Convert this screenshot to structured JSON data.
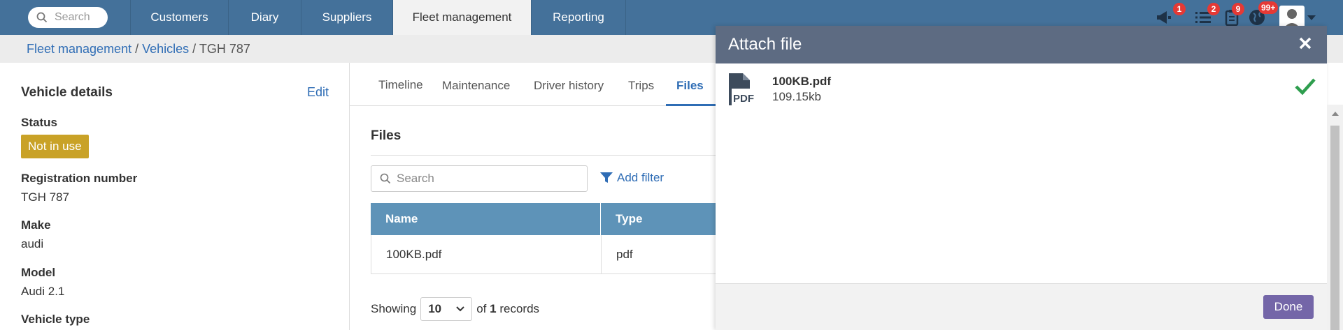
{
  "nav": {
    "search_placeholder": "Search",
    "tabs": [
      {
        "label": "Customers"
      },
      {
        "label": "Diary"
      },
      {
        "label": "Suppliers"
      },
      {
        "label": "Fleet management"
      },
      {
        "label": "Reporting"
      }
    ],
    "badges": {
      "announcements": "1",
      "tasks": "2",
      "clipboard": "9",
      "globe": "99+"
    }
  },
  "breadcrumb": {
    "part1": "Fleet management",
    "sep1": " / ",
    "part2": "Vehicles",
    "sep2": " / ",
    "part3": "TGH 787"
  },
  "vehicle": {
    "title": "Vehicle details",
    "edit": "Edit",
    "status_label": "Status",
    "status_value": "Not in use",
    "reg_label": "Registration number",
    "reg_value": "TGH 787",
    "make_label": "Make",
    "make_value": "audi",
    "model_label": "Model",
    "model_value": "Audi 2.1",
    "type_label": "Vehicle type"
  },
  "detail_tabs": [
    "Timeline",
    "Maintenance",
    "Driver history",
    "Trips",
    "Files"
  ],
  "files": {
    "title": "Files",
    "search_placeholder": "Search",
    "add_filter": "Add filter",
    "columns": [
      "Name",
      "Type"
    ],
    "rows": [
      {
        "name": "100KB.pdf",
        "type": "pdf"
      }
    ],
    "showing": "Showing",
    "page_size": "10",
    "of": "of",
    "count": "1",
    "records": "records"
  },
  "modal": {
    "title": "Attach file",
    "file_name": "100KB.pdf",
    "file_size": "109.15kb",
    "file_badge": "PDF",
    "done": "Done"
  },
  "colors": {
    "nav": "#44719a",
    "accent": "#2f6db5",
    "status": "#c9a227",
    "done": "#7466a8",
    "check": "#2e9e4e"
  }
}
